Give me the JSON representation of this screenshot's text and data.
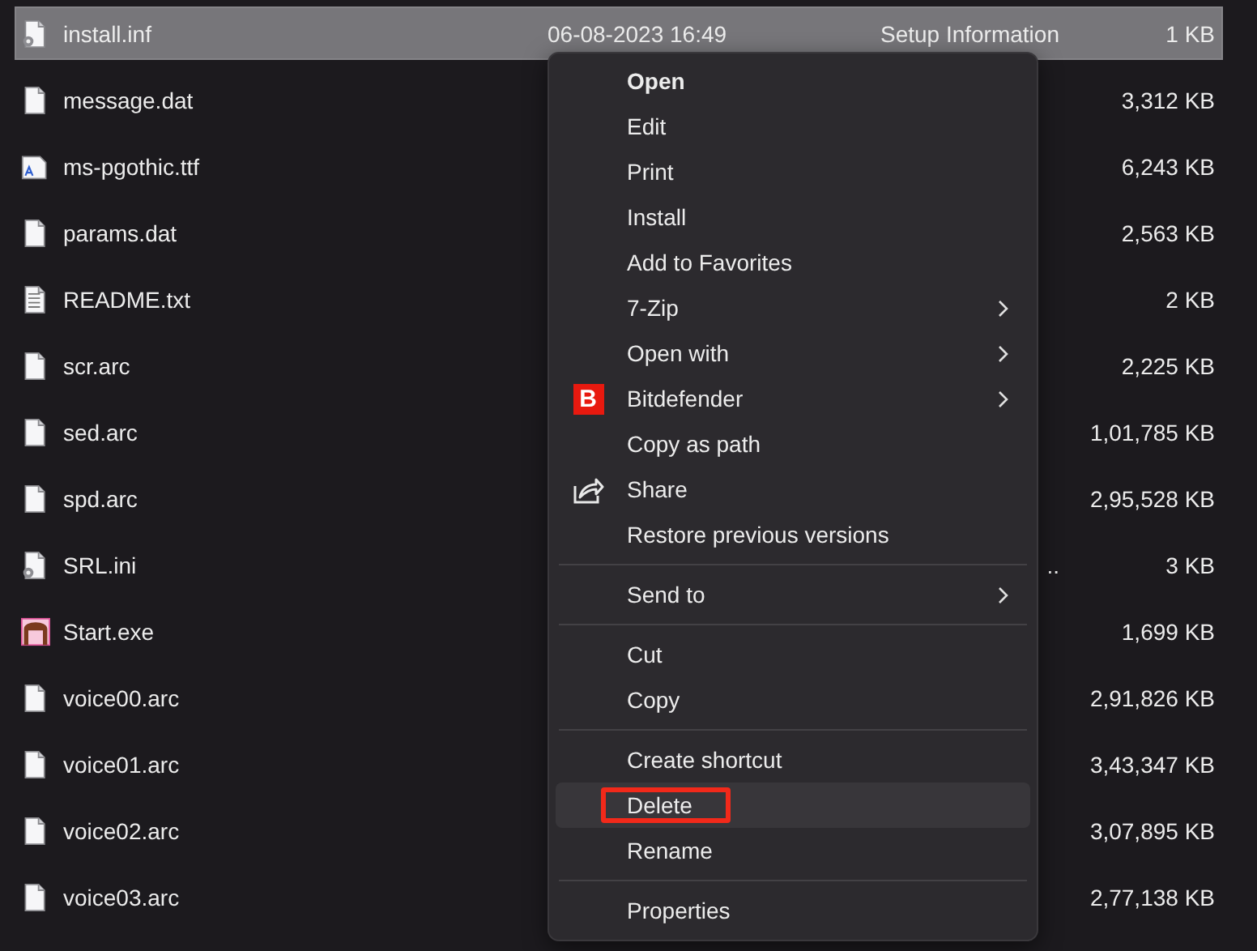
{
  "files": [
    {
      "name": "install.inf",
      "kind": "settings",
      "date": "06-08-2023 16:49",
      "type": "Setup Information",
      "size": "1 KB",
      "selected": true
    },
    {
      "name": "message.dat",
      "kind": "blank",
      "size": "3,312 KB",
      "selected": false
    },
    {
      "name": "ms-pgothic.ttf",
      "kind": "font",
      "size": "6,243 KB",
      "selected": false
    },
    {
      "name": "params.dat",
      "kind": "blank",
      "size": "2,563 KB",
      "selected": false
    },
    {
      "name": "README.txt",
      "kind": "text",
      "size": "2 KB",
      "selected": false
    },
    {
      "name": "scr.arc",
      "kind": "blank",
      "size": "2,225 KB",
      "selected": false
    },
    {
      "name": "sed.arc",
      "kind": "blank",
      "size": "1,01,785 KB",
      "selected": false
    },
    {
      "name": "spd.arc",
      "kind": "blank",
      "size": "2,95,528 KB",
      "selected": false
    },
    {
      "name": "SRL.ini",
      "kind": "settings",
      "type": "..",
      "size": "3 KB",
      "selected": false
    },
    {
      "name": "Start.exe",
      "kind": "app",
      "size": "1,699 KB",
      "selected": false
    },
    {
      "name": "voice00.arc",
      "kind": "blank",
      "size": "2,91,826 KB",
      "selected": false
    },
    {
      "name": "voice01.arc",
      "kind": "blank",
      "size": "3,43,347 KB",
      "selected": false
    },
    {
      "name": "voice02.arc",
      "kind": "blank",
      "size": "3,07,895 KB",
      "selected": false
    },
    {
      "name": "voice03.arc",
      "kind": "blank",
      "size": "2,77,138 KB",
      "selected": false
    }
  ],
  "context_menu": {
    "groups": [
      [
        {
          "label": "Open",
          "default": true,
          "submenu": false,
          "selected": false,
          "circled": false
        },
        {
          "label": "Edit",
          "default": false,
          "submenu": false,
          "selected": false,
          "circled": false
        },
        {
          "label": "Print",
          "default": false,
          "submenu": false,
          "selected": false,
          "circled": false
        },
        {
          "label": "Install",
          "default": false,
          "submenu": false,
          "selected": false,
          "circled": false
        },
        {
          "label": "Add to Favorites",
          "default": false,
          "submenu": false,
          "selected": false,
          "circled": false
        },
        {
          "label": "7-Zip",
          "default": false,
          "submenu": true,
          "selected": false,
          "circled": false
        },
        {
          "label": "Open with",
          "default": false,
          "submenu": true,
          "selected": false,
          "circled": false
        },
        {
          "label": "Bitdefender",
          "default": false,
          "submenu": true,
          "selected": false,
          "circled": false,
          "icon": {
            "kind": "badge",
            "text": "B"
          }
        },
        {
          "label": "Copy as path",
          "default": false,
          "submenu": false,
          "selected": false,
          "circled": false
        },
        {
          "label": "Share",
          "default": false,
          "submenu": false,
          "selected": false,
          "circled": false,
          "icon": {
            "kind": "share"
          }
        },
        {
          "label": "Restore previous versions",
          "default": false,
          "submenu": false,
          "selected": false,
          "circled": false
        }
      ],
      [
        {
          "label": "Send to",
          "default": false,
          "submenu": true,
          "selected": false,
          "circled": false
        }
      ],
      [
        {
          "label": "Cut",
          "default": false,
          "submenu": false,
          "selected": false,
          "circled": false
        },
        {
          "label": "Copy",
          "default": false,
          "submenu": false,
          "selected": false,
          "circled": false
        }
      ],
      [
        {
          "label": "Create shortcut",
          "default": false,
          "submenu": false,
          "selected": false,
          "circled": false
        },
        {
          "label": "Delete",
          "default": false,
          "submenu": false,
          "selected": true,
          "circled": true
        },
        {
          "label": "Rename",
          "default": false,
          "submenu": false,
          "selected": false,
          "circled": false
        }
      ],
      [
        {
          "label": "Properties",
          "default": false,
          "submenu": false,
          "selected": false,
          "circled": false
        }
      ]
    ]
  }
}
